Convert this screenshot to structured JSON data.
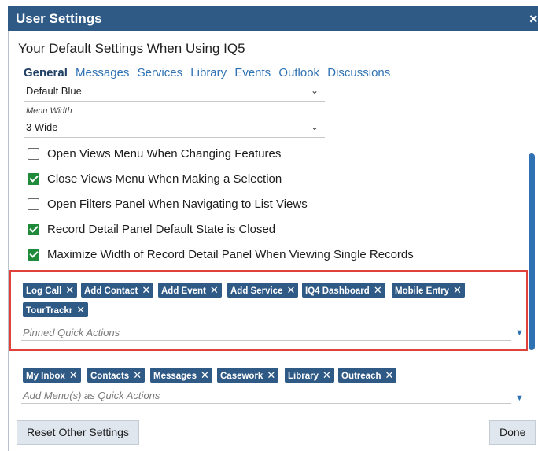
{
  "dialog": {
    "title": "User Settings",
    "close": "×",
    "heading": "Your Default Settings When Using IQ5"
  },
  "tabs": [
    "General",
    "Messages",
    "Services",
    "Library",
    "Events",
    "Outlook",
    "Discussions"
  ],
  "general": {
    "theme_select": {
      "value": "Default Blue"
    },
    "menu_width": {
      "label": "Menu Width",
      "value": "3 Wide"
    },
    "checkboxes": [
      {
        "label": "Open Views Menu When Changing Features",
        "checked": false
      },
      {
        "label": "Close Views Menu When Making a Selection",
        "checked": true
      },
      {
        "label": "Open Filters Panel When Navigating to List Views",
        "checked": false
      },
      {
        "label": "Record Detail Panel Default State is Closed",
        "checked": true
      },
      {
        "label": "Maximize Width of Record Detail Panel When Viewing Single Records",
        "checked": true
      }
    ],
    "pinned_quick_actions": {
      "chips": [
        "Log Call",
        "Add Contact",
        "Add Event",
        "Add Service",
        "IQ4 Dashboard",
        "Mobile Entry",
        "TourTrackr"
      ],
      "placeholder": "Pinned Quick Actions"
    },
    "menu_quick_actions": {
      "chips": [
        "My Inbox",
        "Contacts",
        "Messages",
        "Casework",
        "Library",
        "Outreach"
      ],
      "placeholder": "Add Menu(s) as Quick Actions"
    }
  },
  "footer": {
    "reset_label": "Reset Other Settings",
    "done_label": "Done"
  },
  "colors": {
    "title_bar": "#2f5a86",
    "chip": "#2f5a86",
    "checked": "#1e8a3a",
    "highlight_border": "#e0413b",
    "tab_link": "#2f72b3"
  },
  "icons": {
    "chevron": "chevron-down-icon",
    "remove": "close-icon",
    "dropdown": "triangle-down-icon"
  }
}
